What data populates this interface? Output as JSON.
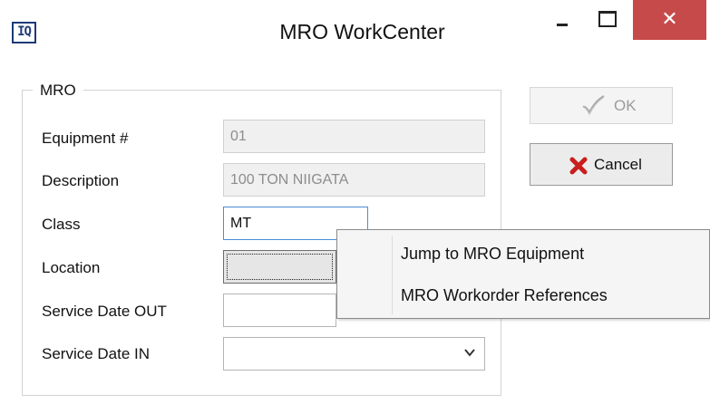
{
  "window": {
    "title": "MRO WorkCenter",
    "app_icon_text": "IQ",
    "close_glyph": "✕"
  },
  "group": {
    "label": "MRO"
  },
  "fields": {
    "equipment": {
      "label": "Equipment #",
      "value": "01"
    },
    "description": {
      "label": "Description",
      "value": "100 TON NIIGATA"
    },
    "class": {
      "label": "Class",
      "value": "MT"
    },
    "location": {
      "label": "Location",
      "value": ""
    },
    "service_date_out": {
      "label": "Service Date OUT",
      "value": ""
    },
    "service_date_in": {
      "label": "Service Date IN",
      "value": ""
    }
  },
  "buttons": {
    "ok": "OK",
    "cancel": "Cancel"
  },
  "context_menu": {
    "items": [
      "Jump to MRO Equipment",
      "MRO Workorder References"
    ]
  },
  "colors": {
    "close_button": "#c74a4a",
    "cancel_icon": "#c81e1e",
    "focus_border": "#4a8ed6"
  }
}
